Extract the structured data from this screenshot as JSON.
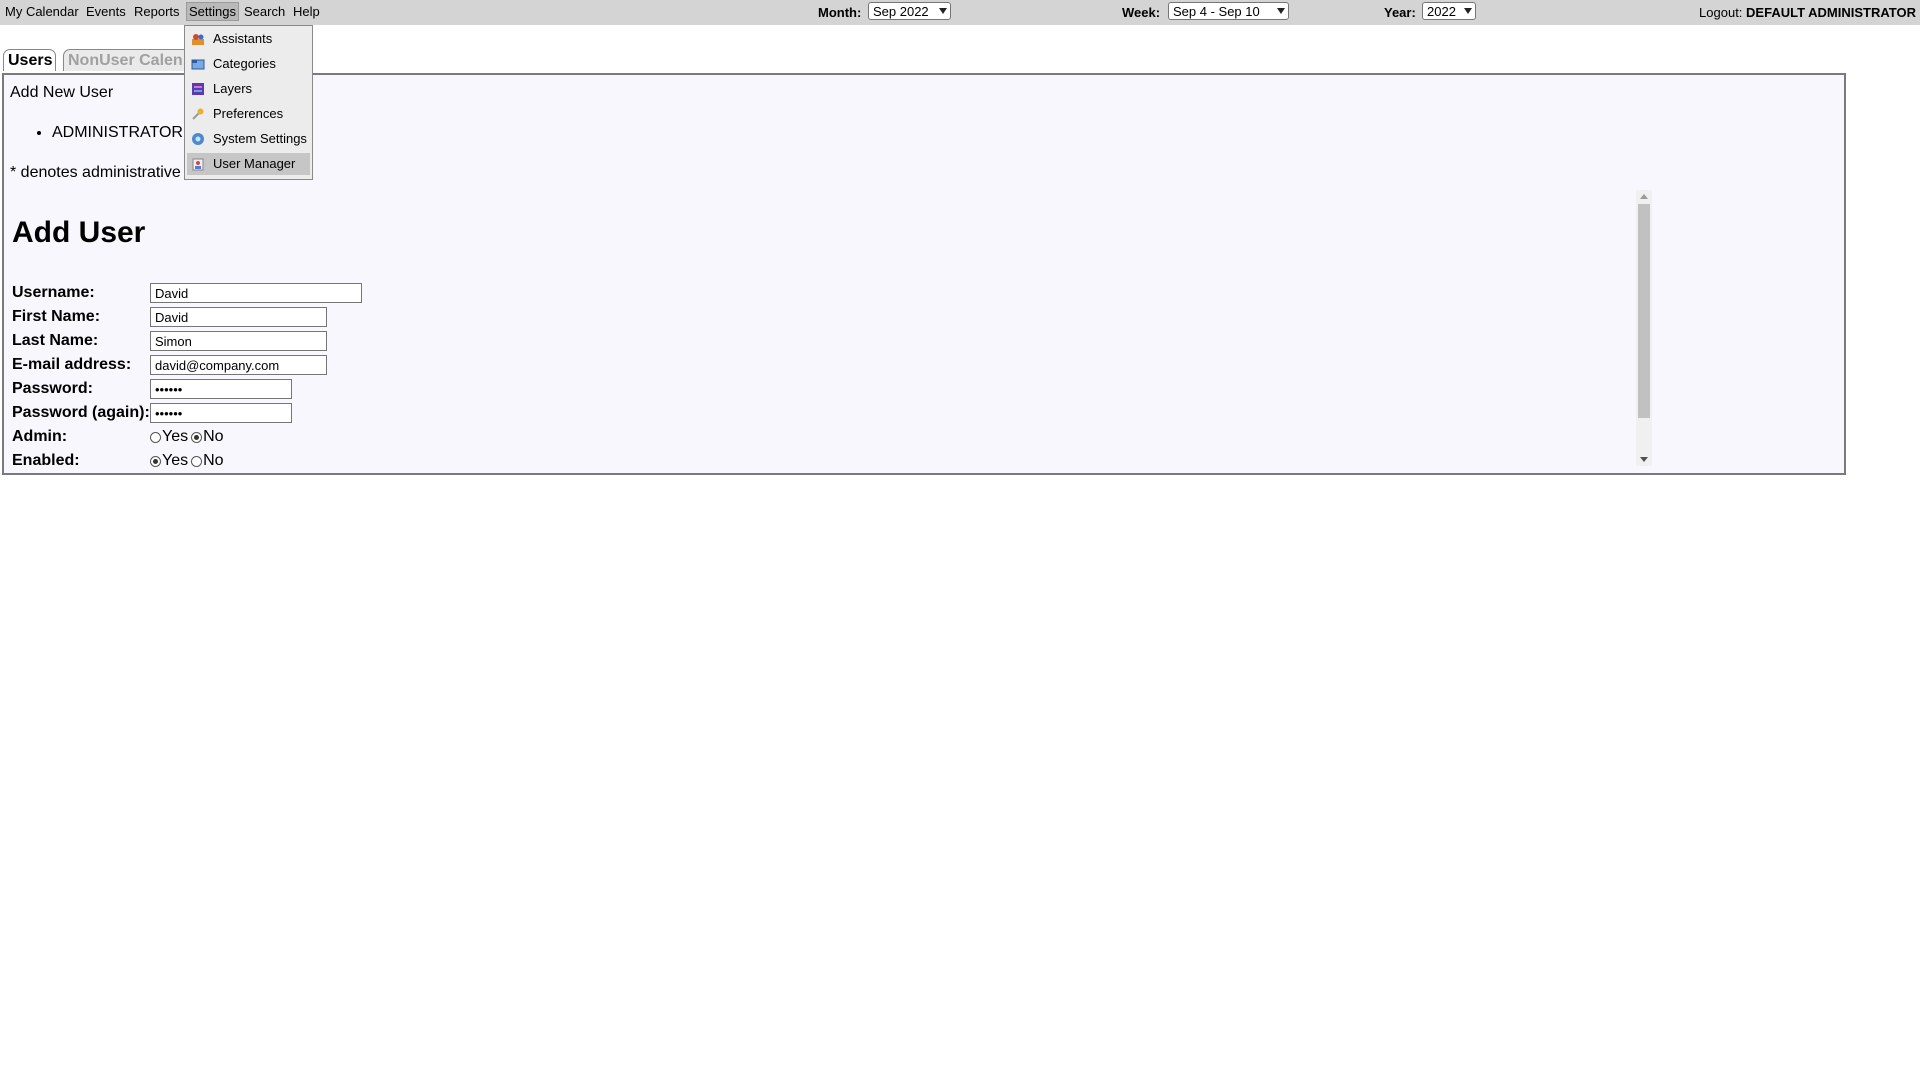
{
  "menubar": {
    "items": [
      "My Calendar",
      "Events",
      "Reports",
      "Settings",
      "Search",
      "Help"
    ],
    "month_label": "Month:",
    "month_value": "Sep 2022",
    "week_label": "Week:",
    "week_value": "Sep 4 - Sep 10",
    "year_label": "Year:",
    "year_value": "2022",
    "logout_label": "Logout:",
    "logout_user": "DEFAULT ADMINISTRATOR"
  },
  "settings_menu": {
    "items": [
      {
        "label": "Assistants",
        "icon": "assistants-icon"
      },
      {
        "label": "Categories",
        "icon": "categories-icon"
      },
      {
        "label": "Layers",
        "icon": "layers-icon"
      },
      {
        "label": "Preferences",
        "icon": "preferences-icon"
      },
      {
        "label": "System Settings",
        "icon": "system-settings-icon"
      },
      {
        "label": "User Manager",
        "icon": "user-manager-icon"
      }
    ],
    "highlighted": "User Manager"
  },
  "tabs": [
    "Users",
    "NonUser Calen"
  ],
  "users_panel": {
    "add_new_user": "Add New User",
    "users": [
      "ADMINISTRATOR"
    ],
    "denotes_note": "* denotes administrative user"
  },
  "form": {
    "title": "Add User",
    "username_label": "Username:",
    "username_value": "David",
    "firstname_label": "First Name:",
    "firstname_value": "David",
    "lastname_label": "Last Name:",
    "lastname_value": "Simon",
    "email_label": "E-mail address:",
    "email_value": "david@company.com",
    "password_label": "Password:",
    "password_value": "••••••",
    "password_again_label": "Password (again):",
    "password_again_value": "••••••",
    "admin_label": "Admin:",
    "admin_value": "No",
    "enabled_label": "Enabled:",
    "enabled_value": "Yes",
    "yes_label": "Yes",
    "no_label": "No"
  }
}
